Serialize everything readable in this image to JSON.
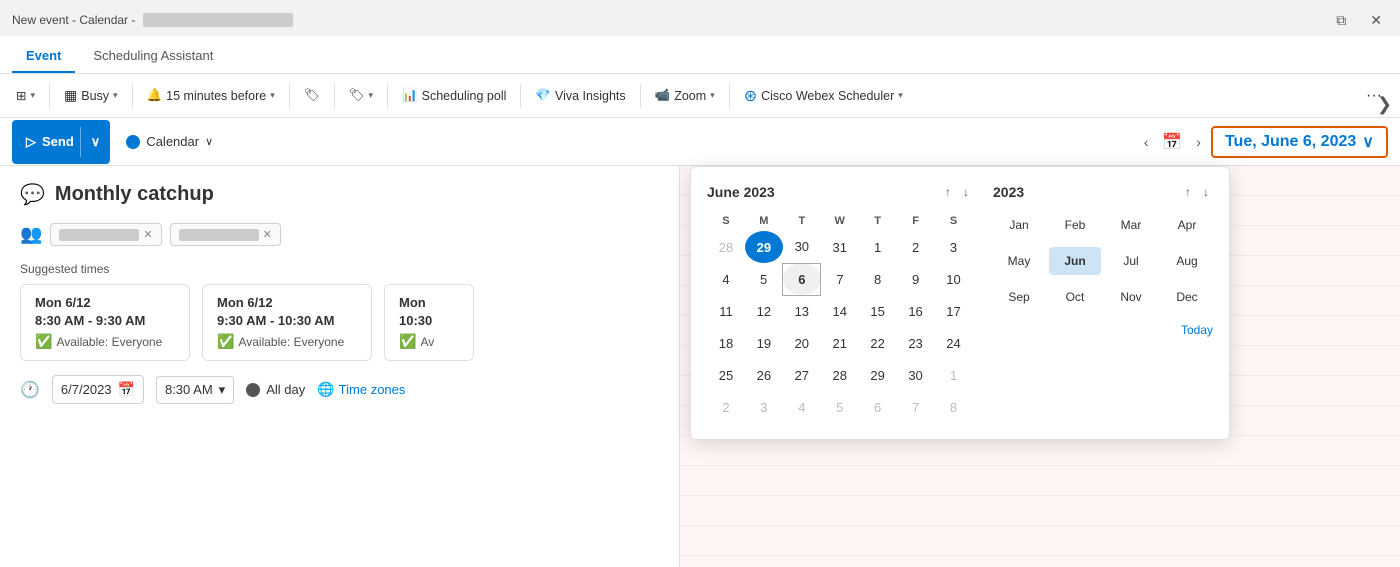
{
  "titleBar": {
    "title": "New event - Calendar -",
    "blurredPart": "████████████",
    "controls": {
      "external": "⧉",
      "close": "✕"
    }
  },
  "tabs": [
    {
      "id": "event",
      "label": "Event",
      "active": true
    },
    {
      "id": "scheduling",
      "label": "Scheduling Assistant",
      "active": false
    }
  ],
  "toolbar": {
    "items": [
      {
        "id": "view-options",
        "label": "",
        "icon": "⊞",
        "hasCaret": true
      },
      {
        "id": "busy",
        "label": "Busy",
        "icon": "▦",
        "hasCaret": true
      },
      {
        "id": "reminder",
        "label": "15 minutes before",
        "icon": "🔔",
        "hasCaret": true
      },
      {
        "id": "tag",
        "label": "",
        "icon": "🏷",
        "hasCaret": false
      },
      {
        "id": "category",
        "label": "",
        "icon": "🏷",
        "hasCaret": true
      },
      {
        "id": "scheduling-poll",
        "label": "Scheduling poll",
        "icon": "📊",
        "hasCaret": false
      },
      {
        "id": "viva-insights",
        "label": "Viva Insights",
        "icon": "💎",
        "hasCaret": false
      },
      {
        "id": "zoom",
        "label": "Zoom",
        "icon": "📹",
        "hasCaret": true
      },
      {
        "id": "webex",
        "label": "Cisco Webex Scheduler",
        "icon": "🔵",
        "hasCaret": true
      }
    ],
    "moreBtn": "···"
  },
  "actionBar": {
    "sendLabel": "Send",
    "sendIcon": "▷",
    "calendarLabel": "Calendar",
    "calendarCaret": "∨",
    "dateDisplay": "Tue, June 6, 2023",
    "dateCaret": "∨"
  },
  "event": {
    "titleIcon": "💬",
    "title": "Monthly catchup",
    "attendees": [
      {
        "id": 1,
        "name": "████████"
      },
      {
        "id": 2,
        "name": "████████"
      }
    ],
    "suggestedTimesLabel": "Suggested times",
    "suggestedCards": [
      {
        "date": "Mon 6/12",
        "time": "8:30 AM - 9:30 AM",
        "available": "Available: Everyone"
      },
      {
        "date": "Mon 6/12",
        "time": "9:30 AM - 10:30 AM",
        "available": "Available: Everyone"
      },
      {
        "date": "Mon",
        "time": "10:30",
        "available": "Av",
        "partial": true
      }
    ],
    "startDate": "6/7/2023",
    "startTime": "8:30 AM",
    "allDayLabel": "All day",
    "timezonesLabel": "Time zones"
  },
  "monthCalendar": {
    "title": "June 2023",
    "weekdays": [
      "S",
      "M",
      "T",
      "W",
      "T",
      "F",
      "S"
    ],
    "weeks": [
      [
        {
          "day": "28",
          "otherMonth": true
        },
        {
          "day": "29",
          "today": true
        },
        {
          "day": "30",
          "otherMonth": false
        },
        {
          "day": "31",
          "otherMonth": false
        },
        {
          "day": "1",
          "otherMonth": false
        },
        {
          "day": "2",
          "otherMonth": false
        },
        {
          "day": "3",
          "otherMonth": false
        }
      ],
      [
        {
          "day": "4"
        },
        {
          "day": "5"
        },
        {
          "day": "6",
          "selected": true
        },
        {
          "day": "7"
        },
        {
          "day": "8"
        },
        {
          "day": "9"
        },
        {
          "day": "10"
        }
      ],
      [
        {
          "day": "11"
        },
        {
          "day": "12"
        },
        {
          "day": "13"
        },
        {
          "day": "14"
        },
        {
          "day": "15"
        },
        {
          "day": "16"
        },
        {
          "day": "17"
        }
      ],
      [
        {
          "day": "18"
        },
        {
          "day": "19"
        },
        {
          "day": "20"
        },
        {
          "day": "21"
        },
        {
          "day": "22"
        },
        {
          "day": "23"
        },
        {
          "day": "24"
        }
      ],
      [
        {
          "day": "25"
        },
        {
          "day": "26"
        },
        {
          "day": "27"
        },
        {
          "day": "28"
        },
        {
          "day": "29"
        },
        {
          "day": "30"
        },
        {
          "day": "1",
          "otherMonth": true
        }
      ],
      [
        {
          "day": "2",
          "otherMonth": true
        },
        {
          "day": "3",
          "otherMonth": true
        },
        {
          "day": "4",
          "otherMonth": true
        },
        {
          "day": "5",
          "otherMonth": true
        },
        {
          "day": "6",
          "otherMonth": true
        },
        {
          "day": "7",
          "otherMonth": true
        },
        {
          "day": "8",
          "otherMonth": true
        }
      ]
    ]
  },
  "yearCalendar": {
    "year": "2023",
    "months": [
      {
        "label": "Jan",
        "selected": false
      },
      {
        "label": "Feb",
        "selected": false
      },
      {
        "label": "Mar",
        "selected": false
      },
      {
        "label": "Apr",
        "selected": false
      },
      {
        "label": "May",
        "selected": false
      },
      {
        "label": "Jun",
        "selected": true
      },
      {
        "label": "Jul",
        "selected": false
      },
      {
        "label": "Aug",
        "selected": false
      },
      {
        "label": "Sep",
        "selected": false
      },
      {
        "label": "Oct",
        "selected": false
      },
      {
        "label": "Nov",
        "selected": false
      },
      {
        "label": "Dec",
        "selected": false
      }
    ],
    "todayLabel": "Today"
  }
}
